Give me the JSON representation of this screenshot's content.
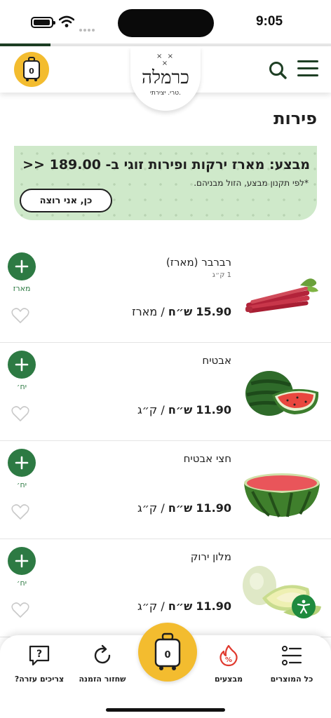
{
  "status_bar": {
    "time": "9:05"
  },
  "header": {
    "cart_count": "0",
    "logo": {
      "name": "כרמלה",
      "tagline": "טרי. יצירתי."
    }
  },
  "page": {
    "title": "פירות"
  },
  "promo": {
    "title": "מבצע: מארז ירקות ופירות זוגי ב- 189.00 <<",
    "note": "*לפי תקנון מבצע, הזול מבניהם.",
    "button_label": "כן, אני רוצה"
  },
  "products": [
    {
      "name": "רברבר (מארז)",
      "sub": "1 ק״ג",
      "price": "15.90",
      "currency": "ש״ח",
      "unit": "/ מארז",
      "add_unit_label": "מארז",
      "image_icon": "rhubarb-image"
    },
    {
      "name": "אבטיח",
      "sub": "",
      "price": "11.90",
      "currency": "ש״ח",
      "unit": "/ ק״ג",
      "add_unit_label": "יח׳",
      "image_icon": "watermelon-image"
    },
    {
      "name": "חצי אבטיח",
      "sub": "",
      "price": "11.90",
      "currency": "ש״ח",
      "unit": "/ ק״ג",
      "add_unit_label": "יח׳",
      "image_icon": "half-watermelon-image"
    },
    {
      "name": "מלון ירוק",
      "sub": "",
      "price": "11.90",
      "currency": "ש״ח",
      "unit": "/ ק״ג",
      "add_unit_label": "יח׳",
      "image_icon": "melon-image"
    }
  ],
  "bottom_nav": {
    "cart_count": "0",
    "items": [
      {
        "label": "כל המוצרים",
        "icon": "list-icon"
      },
      {
        "label": "מבצעים",
        "icon": "percent-flame-icon"
      },
      {
        "label": "שחזור הזמנה",
        "icon": "refresh-icon"
      },
      {
        "label": "צריכים עזרה?",
        "icon": "help-chat-icon"
      }
    ]
  },
  "colors": {
    "brand_green": "#2d7a43",
    "dark_green": "#1e3f24",
    "accent_yellow": "#f3bc2f",
    "promo_bg": "#cfe9ca",
    "sale_red": "#e03a2f"
  }
}
